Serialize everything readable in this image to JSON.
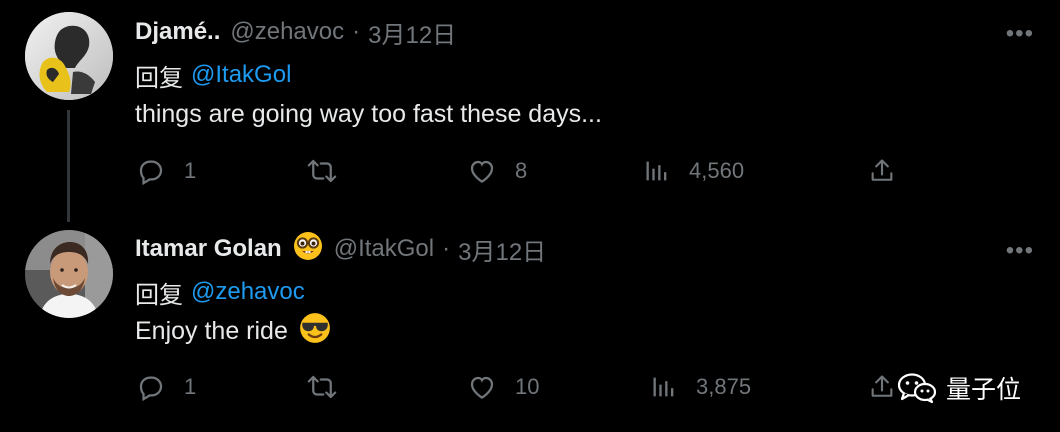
{
  "tweets": [
    {
      "name": "Djamé..",
      "handle": "@zehavoc",
      "separator": "·",
      "date": "3月12日",
      "reply_prefix": "回复",
      "reply_to": "@ItakGol",
      "text": "things are going way too fast these days...",
      "name_emoji": "",
      "text_emoji": "",
      "stats": {
        "replies": "1",
        "retweets": "",
        "likes": "8",
        "views": "4,560"
      }
    },
    {
      "name": "Itamar Golan",
      "handle": "@ItakGol",
      "separator": "·",
      "date": "3月12日",
      "reply_prefix": "回复",
      "reply_to": "@zehavoc",
      "text": "Enjoy the ride",
      "name_emoji": "nerd-face",
      "text_emoji": "sunglasses-face",
      "stats": {
        "replies": "1",
        "retweets": "",
        "likes": "10",
        "views": "3,875"
      }
    }
  ],
  "more_label": "•••",
  "watermark": {
    "text": "量子位",
    "icon": "wechat-icon"
  },
  "colors": {
    "background": "#000000",
    "text": "#e7e9ea",
    "muted": "#71767b",
    "link": "#1d9bf0",
    "thread": "#333639"
  }
}
